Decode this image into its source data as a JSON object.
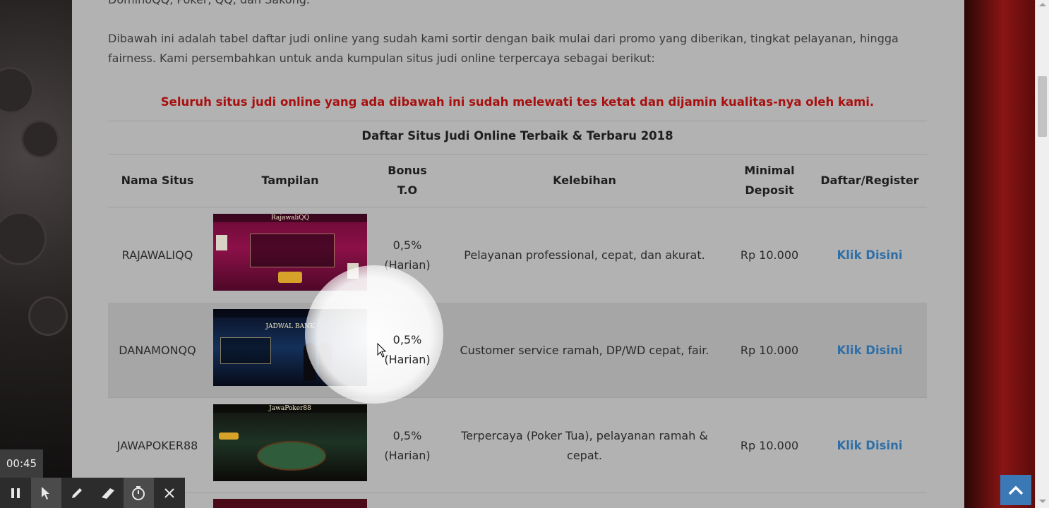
{
  "article": {
    "intro_tail": "DominoQQ, Poker, QQ, dan Sakong.",
    "paragraph": "Dibawah ini adalah tabel daftar judi online yang sudah kami sortir dengan baik mulai dari promo yang diberikan, tingkat pelayanan, hingga fairness. Kami persembahkan untuk anda kumpulan situs judi online terpercaya sebagai berikut:",
    "warning": "Seluruh situs judi online yang ada dibawah ini sudah melewati tes ketat dan dijamin kualitas-nya oleh kami."
  },
  "table": {
    "caption": "Daftar Situs Judi Online Terbaik & Terbaru 2018",
    "headers": {
      "name": "Nama Situs",
      "preview": "Tampilan",
      "bonus_line1": "Bonus",
      "bonus_line2": "T.O",
      "advantages": "Kelebihan",
      "deposit_line1": "Minimal",
      "deposit_line2": "Deposit",
      "register": "Daftar/Register"
    },
    "rows": [
      {
        "name": "RAJAWALIQQ",
        "thumb_brand": "RajawaliQQ",
        "bonus_pct": "0,5%",
        "bonus_period": "(Harian)",
        "advantages": "Pelayanan professional, cepat, dan akurat.",
        "deposit": "Rp 10.000",
        "link": "Klik Disini"
      },
      {
        "name": "DANAMONQQ",
        "thumb_brand": "JADWAL BANK",
        "bonus_pct": "0,5%",
        "bonus_period": "(Harian)",
        "advantages": "Customer service ramah, DP/WD cepat, fair.",
        "deposit": "Rp 10.000",
        "link": "Klik Disini"
      },
      {
        "name": "JAWAPOKER88",
        "thumb_brand": "JawaPoker88",
        "bonus_pct": "0,5%",
        "bonus_period": "(Harian)",
        "advantages": "Terpercaya (Poker Tua), pelayanan ramah & cepat.",
        "deposit": "Rp 10.000",
        "link": "Klik Disini"
      }
    ]
  },
  "recorder": {
    "elapsed": "00:45"
  },
  "colors": {
    "warning": "#a81010",
    "link": "#2f6fa8",
    "to_top_button": "#3a79b5",
    "page_bg": "#b2b2b2"
  },
  "icons": [
    "pause-icon",
    "pointer-icon",
    "pencil-icon",
    "highlighter-icon",
    "stopwatch-icon",
    "close-icon",
    "chevron-up-icon",
    "mouse-cursor-icon"
  ]
}
